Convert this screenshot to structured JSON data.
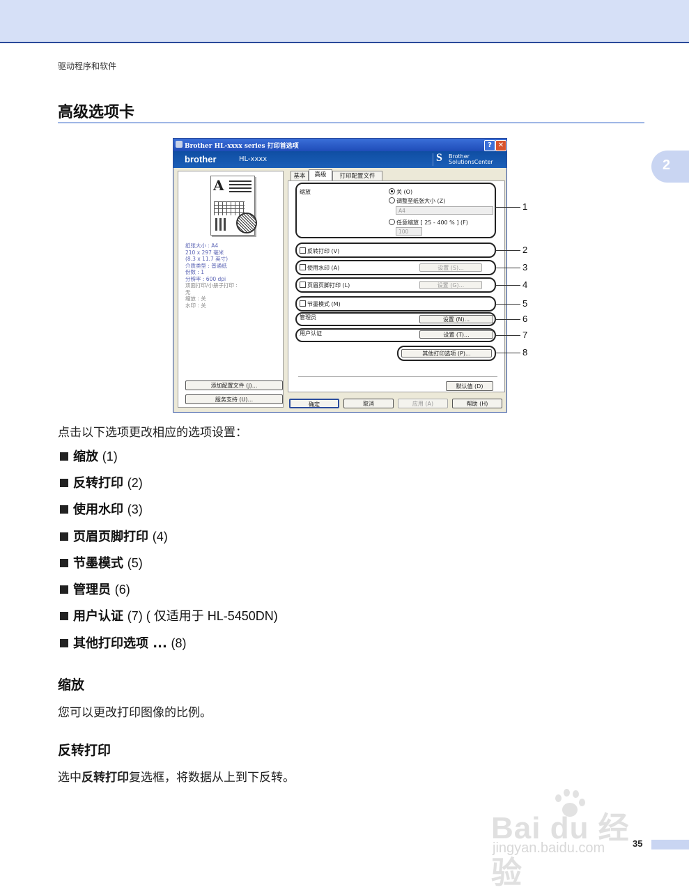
{
  "running_head": "驱动程序和软件",
  "section_title": "高级选项卡",
  "chapter_number": "2",
  "dialog": {
    "title": "Brother HL-xxxx series 打印首选项",
    "help_button": "?",
    "close_button": "✕",
    "brand": "brother",
    "model": "HL-xxxx",
    "solutions_logo_line1": "Brother",
    "solutions_logo_line2": "SolutionsCenter",
    "tabs": [
      "基本",
      "高级",
      "打印配置文件"
    ],
    "active_tab": "高级",
    "settings_summary": [
      "纸张大小 : A4",
      "210 x 297 毫米",
      "(8.3 x 11.7 英寸)",
      "介质类型 : 普通纸",
      "份数 : 1",
      "分辨率 : 600 dpi",
      "双面打印/小册子打印 :",
      "无",
      "缩放 : 关",
      "水印 : 关"
    ],
    "add_profile_button": "添加配置文件 (J)...",
    "support_button": "服务支持 (U)...",
    "scaling": {
      "label": "缩放",
      "off": "关 (O)",
      "fit_to_paper": "调整至纸张大小 (Z)",
      "paper_value": "A4",
      "free": "任意缩放 [ 25 - 400 % ] (F)",
      "percent_value": "100"
    },
    "reverse_print": "反转打印 (V)",
    "watermark": "使用水印 (A)",
    "watermark_settings": "设置 (S)...",
    "header_footer": "页眉页脚打印 (L)",
    "header_footer_settings": "设置 (G)...",
    "toner_save": "节墨模式 (M)",
    "administrator": "管理员",
    "administrator_settings": "设置 (N)...",
    "user_auth": "用户认证",
    "user_auth_settings": "设置 (T)...",
    "other_options": "其他打印选项 (P)...",
    "default_button": "默认值 (D)",
    "ok_button": "确定",
    "cancel_button": "取消",
    "apply_button": "应用 (A)",
    "help_btn": "帮助 (H)",
    "callouts": [
      "1",
      "2",
      "3",
      "4",
      "5",
      "6",
      "7",
      "8"
    ]
  },
  "intro": "点击以下选项更改相应的选项设置：",
  "bullets": [
    {
      "label": "缩放",
      "num": "(1)"
    },
    {
      "label": "反转打印",
      "num": "(2)"
    },
    {
      "label": "使用水印",
      "num": "(3)"
    },
    {
      "label": "页眉页脚打印",
      "num": "(4)"
    },
    {
      "label": "节墨模式",
      "num": "(5)"
    },
    {
      "label": "管理员",
      "num": "(6)"
    },
    {
      "label": "用户认证",
      "num": "(7) ( 仅适用于 HL-5450DN)"
    },
    {
      "label": "其他打印选项 ...",
      "num": "(8)"
    }
  ],
  "scaling_heading": "缩放",
  "scaling_para": "您可以更改打印图像的比例。",
  "reverse_heading": "反转打印",
  "reverse_para_pre": "选中",
  "reverse_para_bold": "反转打印",
  "reverse_para_post": "复选框，将数据从上到下反转。",
  "watermark_text_1": "Bai du 经验",
  "watermark_text_2": "jingyan.baidu.com",
  "page_number": "35"
}
